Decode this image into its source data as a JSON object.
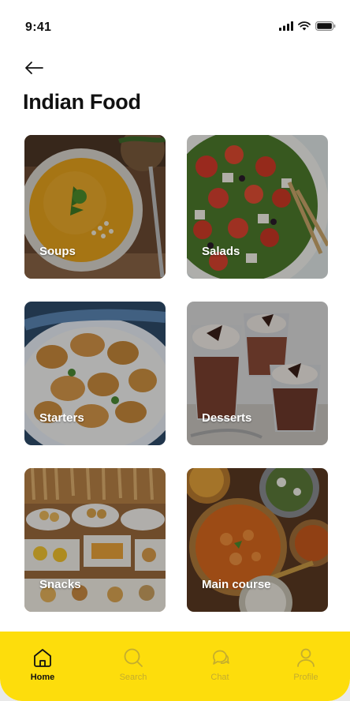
{
  "status_bar": {
    "time": "9:41",
    "icons": [
      "signal-icon",
      "wifi-icon",
      "battery-icon"
    ]
  },
  "header": {
    "back_icon": "arrow-left-icon",
    "title": "Indian Food"
  },
  "categories": [
    {
      "label": "Soups"
    },
    {
      "label": "Salads"
    },
    {
      "label": "Starters"
    },
    {
      "label": "Desserts"
    },
    {
      "label": "Snacks"
    },
    {
      "label": "Main course"
    }
  ],
  "bottom_nav": {
    "items": [
      {
        "label": "Home",
        "icon": "home-icon",
        "active": true
      },
      {
        "label": "Search",
        "icon": "search-icon",
        "active": false
      },
      {
        "label": "Chat",
        "icon": "chat-icon",
        "active": false
      },
      {
        "label": "Profile",
        "icon": "profile-icon",
        "active": false
      }
    ]
  },
  "colors": {
    "nav_background": "#fddd0c",
    "nav_inactive": "#c4ad2e",
    "text": "#111111"
  }
}
